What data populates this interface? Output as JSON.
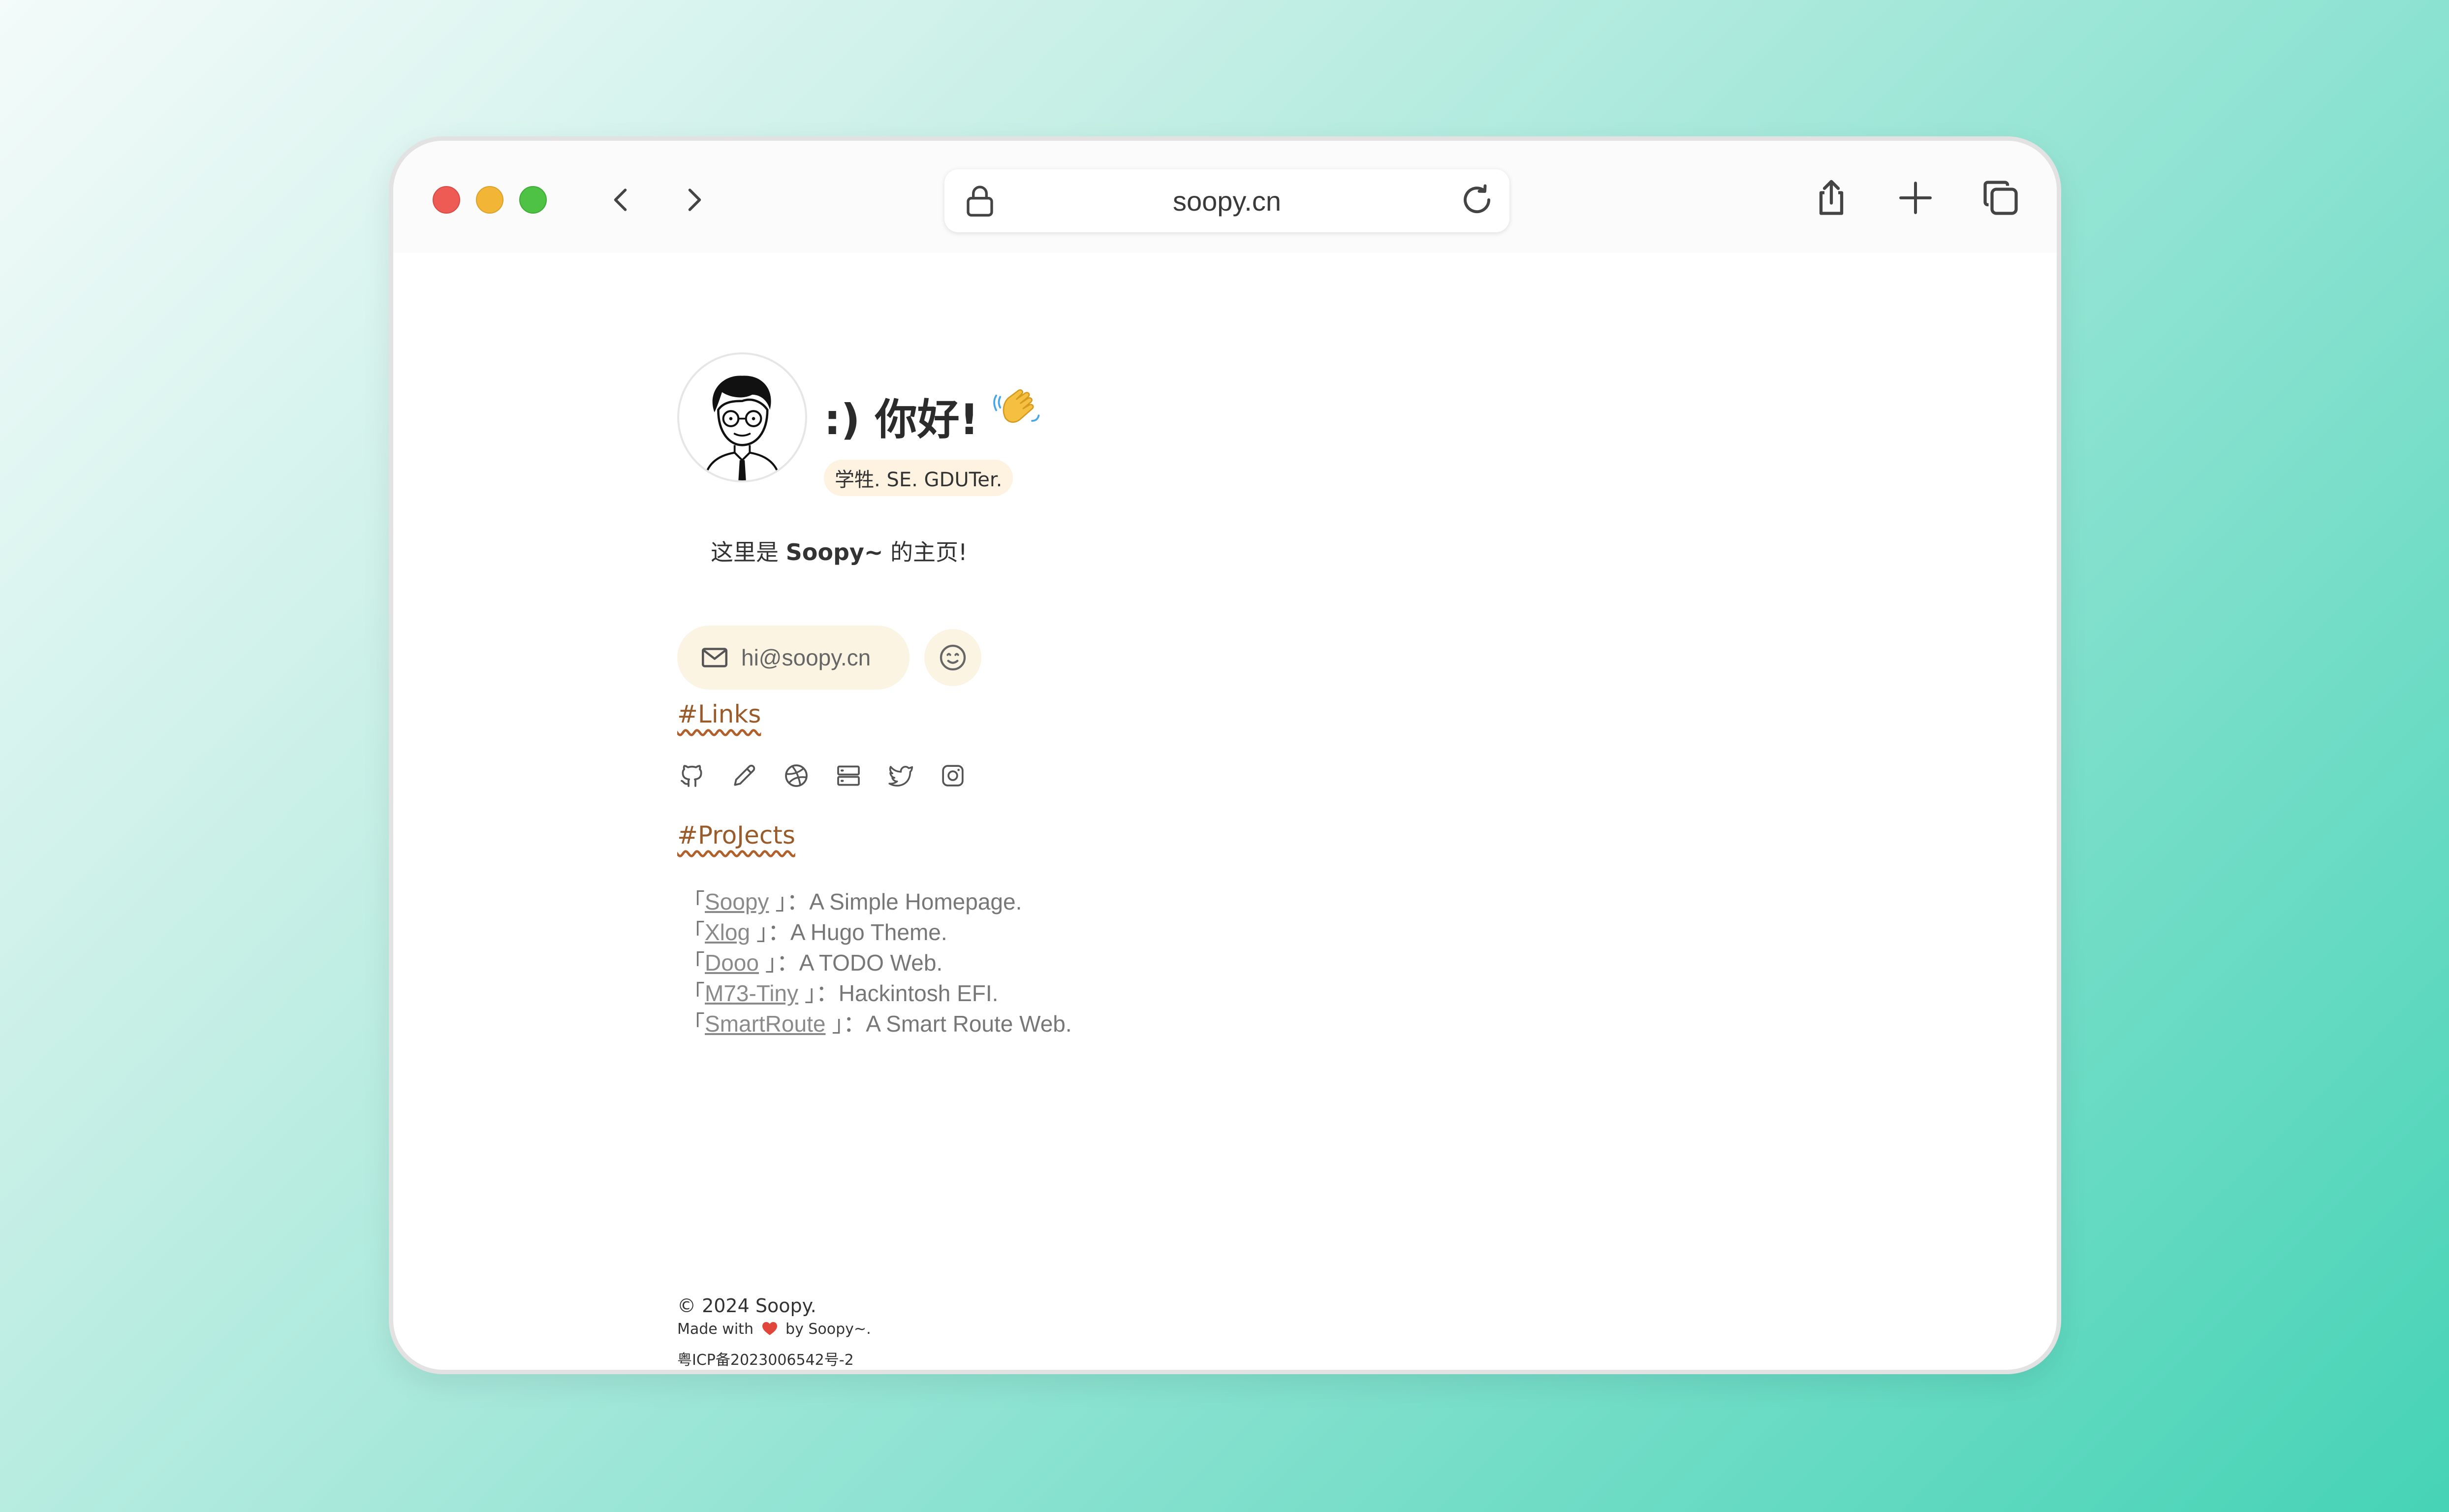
{
  "browser": {
    "url": "soopy.cn"
  },
  "profile": {
    "greeting": ":) 你好!",
    "tagline": "学牲. SE. GDUTer.",
    "intro_prefix": "这里是 ",
    "intro_name": "Soopy~",
    "intro_suffix": " 的主页!",
    "email": "hi@soopy.cn"
  },
  "links": {
    "title": "#Links",
    "icons": [
      "github-icon",
      "pencil-icon",
      "dribbble-icon",
      "server-icon",
      "twitter-icon",
      "instagram-icon"
    ]
  },
  "projects": {
    "title": "#ProJects",
    "items": [
      {
        "name": "Soopy",
        "desc": "A Simple Homepage."
      },
      {
        "name": "Xlog",
        "desc": "A Hugo Theme."
      },
      {
        "name": "Dooo",
        "desc": "A TODO Web."
      },
      {
        "name": "M73-Tiny",
        "desc": "Hackintosh EFI."
      },
      {
        "name": "SmartRoute",
        "desc": "A Smart Route Web."
      }
    ],
    "open_bracket": "「",
    "close_bracket": "」",
    "separator": "："
  },
  "footer": {
    "copyright": "© 2024 Soopy.",
    "made_with_prefix": "Made with",
    "made_with_suffix": "by Soopy~.",
    "icp": "粤ICP备2023006542号-2"
  },
  "colors": {
    "accent": "#9a5b2a",
    "pill_bg": "#fcf4e3",
    "heart": "#e0463a"
  }
}
